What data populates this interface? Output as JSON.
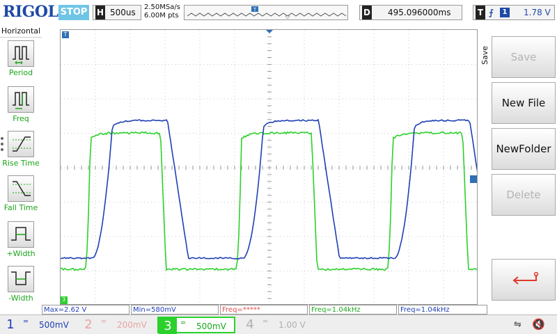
{
  "topbar": {
    "logo": "RIGOL",
    "run_state": "STOP",
    "horizontal": {
      "key": "H",
      "value": "500us"
    },
    "sample_rate": "2.50MSa/s",
    "mem_depth": "6.00M pts",
    "delay": {
      "key": "D",
      "value": "495.096000ms"
    },
    "trigger": {
      "key": "T",
      "edge_symbol": "⨍",
      "source": "1",
      "level": "1.78 V"
    }
  },
  "left_menu": {
    "title": "Horizontal",
    "items": [
      {
        "label": "Period",
        "icon": "period-icon"
      },
      {
        "label": "Freq",
        "icon": "freq-icon"
      },
      {
        "label": "Rise Time",
        "icon": "rise-time-icon"
      },
      {
        "label": "Fall Time",
        "icon": "fall-time-icon"
      },
      {
        "label": "+Width",
        "icon": "positive-width-icon"
      },
      {
        "label": "-Width",
        "icon": "negative-width-icon"
      }
    ]
  },
  "right_menu": {
    "title": "Save",
    "buttons": [
      {
        "label": "Save",
        "enabled": false
      },
      {
        "label": "New File",
        "enabled": true
      },
      {
        "label": "NewFolder",
        "enabled": true
      },
      {
        "label": "Delete",
        "enabled": false
      },
      {
        "label": "",
        "icon": "return-arrow-icon",
        "enabled": true
      }
    ]
  },
  "measurements": [
    {
      "text": "Max=2.62 V",
      "color": "#1e3fb4"
    },
    {
      "text": "Min=580mV",
      "color": "#1e3fb4"
    },
    {
      "text": "Freq=*****",
      "color": "#e24b4b"
    },
    {
      "text": "Freq=1.04kHz",
      "color": "#1fa81f"
    },
    {
      "text": "Freq=1.04kHz",
      "color": "#1e3fb4"
    }
  ],
  "channels": [
    {
      "num": "1",
      "coupling": "═",
      "scale": "500mV",
      "color": "#1e3fb4",
      "active": false,
      "enabled": true
    },
    {
      "num": "2",
      "coupling": "═",
      "scale": "200mV",
      "color": "#e8a3a3",
      "active": false,
      "enabled": false
    },
    {
      "num": "3",
      "coupling": "═",
      "scale": "500mV",
      "color": "#1fa81f",
      "active": true,
      "enabled": true
    },
    {
      "num": "4",
      "coupling": "═",
      "scale": "1.00 V",
      "color": "#b0b0b0",
      "active": false,
      "enabled": false
    }
  ],
  "status": {
    "usb_icon": "usb-icon",
    "sound_icon": "speaker-muted-icon",
    "usb_glyph": "⇋",
    "sound_glyph": "🔇"
  },
  "colors": {
    "ch1": "#1e3fb4",
    "ch3": "#2bd12b",
    "grid": "#c8c8c8",
    "ch3_text": "#1aa51a"
  }
}
